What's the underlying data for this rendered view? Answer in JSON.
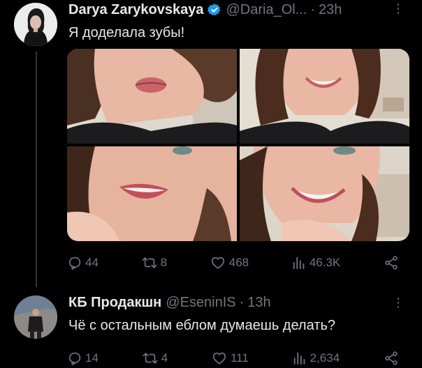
{
  "tweet": {
    "author_name": "Darya Zarykovskaya",
    "handle": "@Daria_Ol...",
    "separator": "·",
    "time": "23h",
    "more": "⋮",
    "text": "Я доделала зубы!",
    "replies": "44",
    "retweets": "8",
    "likes": "468",
    "views": "46.3K"
  },
  "reply": {
    "author_name": "КБ Продакшн",
    "handle": "@EseninIS",
    "separator": "·",
    "time": "13h",
    "more": "⋮",
    "text": "Чё с остальным еблом думаешь делать?",
    "replies": "14",
    "retweets": "4",
    "likes": "111",
    "views": "2,634"
  },
  "colors": {
    "background": "#000000",
    "text": "#e7e9ea",
    "muted": "#71767b",
    "verified": "#1d9bf0",
    "thread_line": "#333639"
  },
  "icons": [
    "verified-badge-icon",
    "more-icon",
    "reply-icon",
    "retweet-icon",
    "like-icon",
    "views-icon",
    "share-icon"
  ]
}
